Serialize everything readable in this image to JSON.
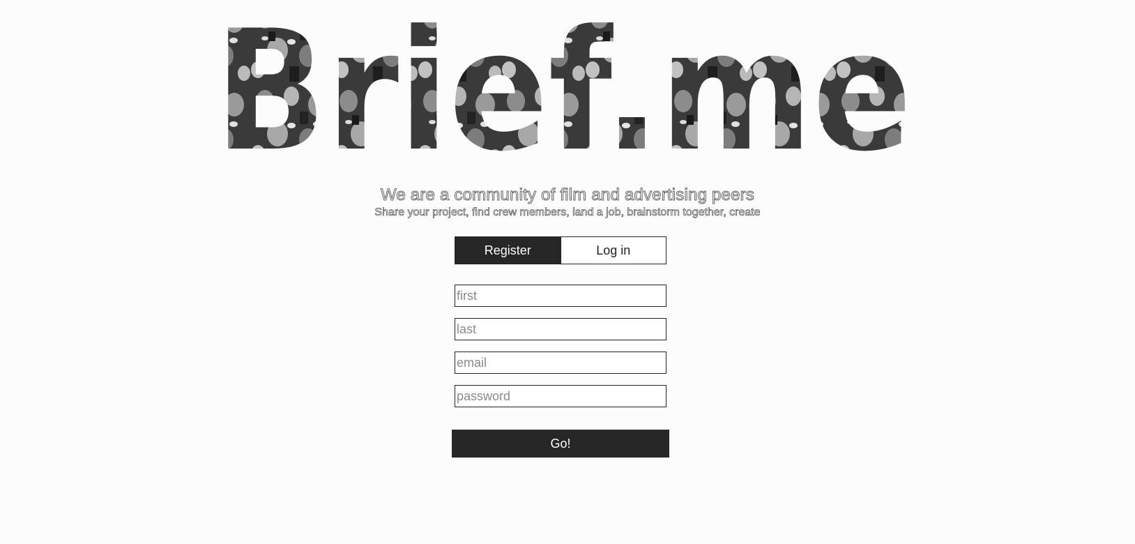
{
  "logo": {
    "text": "Brief.me"
  },
  "hero": {
    "tagline": "We are a community of film and advertising peers",
    "subtagline": "Share your project, find crew members, land a job, brainstorm together, create"
  },
  "tabs": {
    "register_label": "Register",
    "login_label": "Log in",
    "active": "register"
  },
  "form": {
    "first_placeholder": "first",
    "last_placeholder": "last",
    "email_placeholder": "email",
    "password_placeholder": "password",
    "first_value": "",
    "last_value": "",
    "email_value": "",
    "password_value": "",
    "submit_label": "Go!"
  },
  "colors": {
    "background": "#fcfcfc",
    "dark": "#262626",
    "placeholder": "#8a8a8a"
  }
}
